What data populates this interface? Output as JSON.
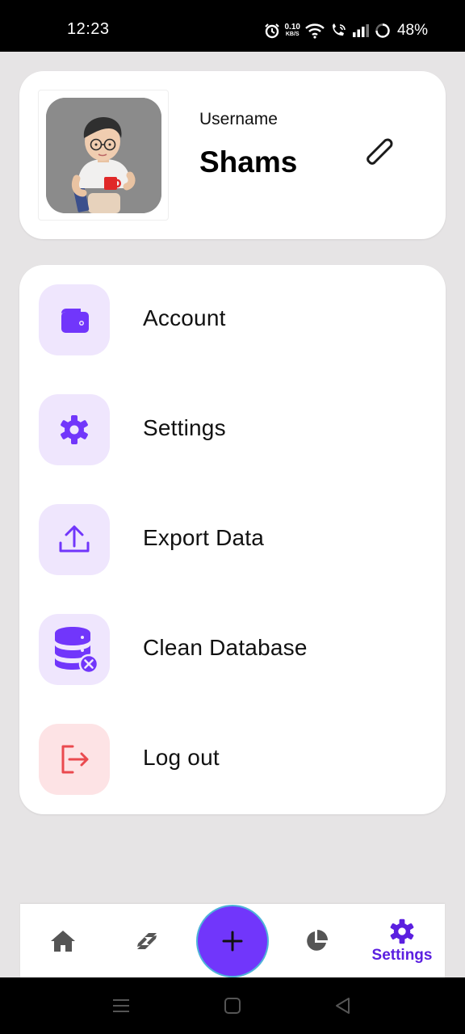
{
  "status_bar": {
    "time": "12:23",
    "net_speed_value": "0.10",
    "net_speed_unit": "KB/S",
    "battery": "48%"
  },
  "profile": {
    "username_label": "Username",
    "username": "Shams"
  },
  "menu": {
    "items": [
      {
        "label": "Account",
        "icon": "wallet-icon"
      },
      {
        "label": "Settings",
        "icon": "gear-icon"
      },
      {
        "label": "Export Data",
        "icon": "upload-icon"
      },
      {
        "label": "Clean Database",
        "icon": "database-remove-icon"
      },
      {
        "label": "Log out",
        "icon": "logout-icon"
      }
    ]
  },
  "bottom_nav": {
    "items": [
      {
        "name": "home",
        "icon": "home-icon"
      },
      {
        "name": "transactions",
        "icon": "swap-icon"
      },
      {
        "name": "add",
        "icon": "plus-icon"
      },
      {
        "name": "stats",
        "icon": "pie-chart-icon"
      },
      {
        "name": "settings",
        "icon": "gear-icon",
        "label": "Settings",
        "active": true
      }
    ]
  },
  "colors": {
    "accent": "#7136fb",
    "accent_light": "#efe6fd",
    "danger": "#ea4a4f",
    "danger_light": "#fde3e5",
    "background": "#e6e4e5",
    "active_nav": "#5b1fe0"
  }
}
